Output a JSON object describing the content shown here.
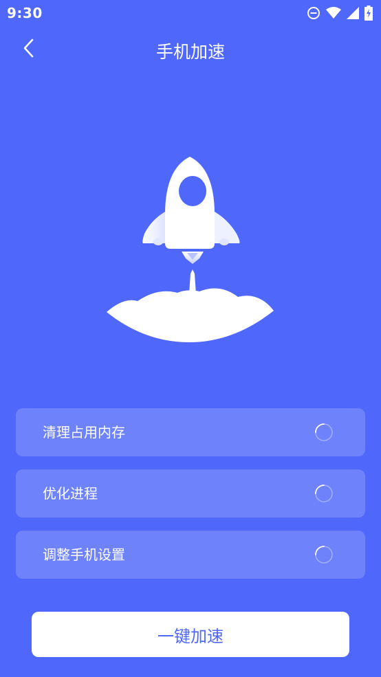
{
  "status_bar": {
    "time": "9:30",
    "icons": [
      "do-not-disturb-icon",
      "wifi-icon",
      "signal-icon",
      "battery-charging-icon"
    ]
  },
  "app_bar": {
    "title": "手机加速",
    "back_icon": "chevron-left-icon"
  },
  "hero": {
    "icon": "rocket-launch-illustration"
  },
  "tasks": [
    {
      "label": "清理占用内存",
      "status_icon": "loading-spinner-icon"
    },
    {
      "label": "优化进程",
      "status_icon": "loading-spinner-icon"
    },
    {
      "label": "调整手机设置",
      "status_icon": "loading-spinner-icon"
    }
  ],
  "action": {
    "label": "一键加速"
  },
  "colors": {
    "background": "#4f68fb",
    "card": "#7188fc",
    "button_text": "#4f68fb"
  }
}
